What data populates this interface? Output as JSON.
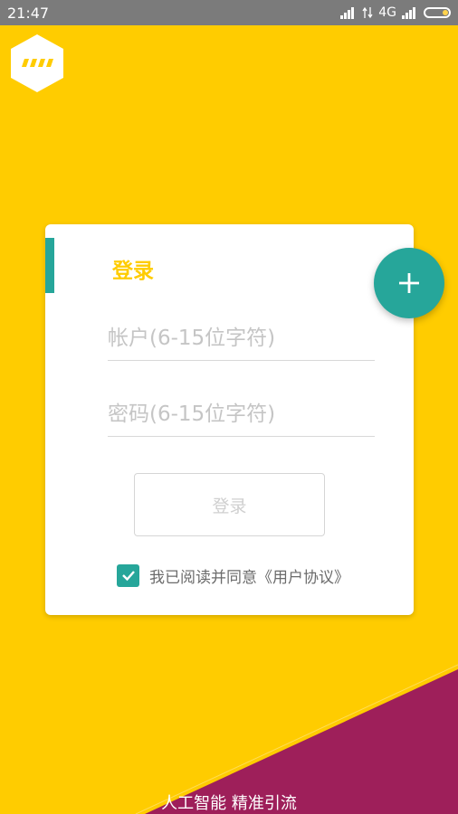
{
  "status_bar": {
    "time": "21:47",
    "network": "4G",
    "icons": [
      "signal-icon",
      "data-arrows-icon",
      "signal-icon",
      "battery-icon"
    ]
  },
  "app": {
    "logo_icon": "hexagon-logo-icon",
    "slogan": "人工智能 精准引流",
    "colors": {
      "background": "#FFCC00",
      "accent": "#26A69A",
      "bottom_shape": "#9E1F5A",
      "title": "#FFCC00"
    }
  },
  "login_card": {
    "title": "登录",
    "account_placeholder": "帐户(6-15位字符)",
    "password_placeholder": "密码(6-15位字符)",
    "login_button_label": "登录",
    "agreement_text": "我已阅读并同意《用户协议》",
    "agreement_checked": true
  },
  "fab": {
    "icon": "plus-icon"
  }
}
